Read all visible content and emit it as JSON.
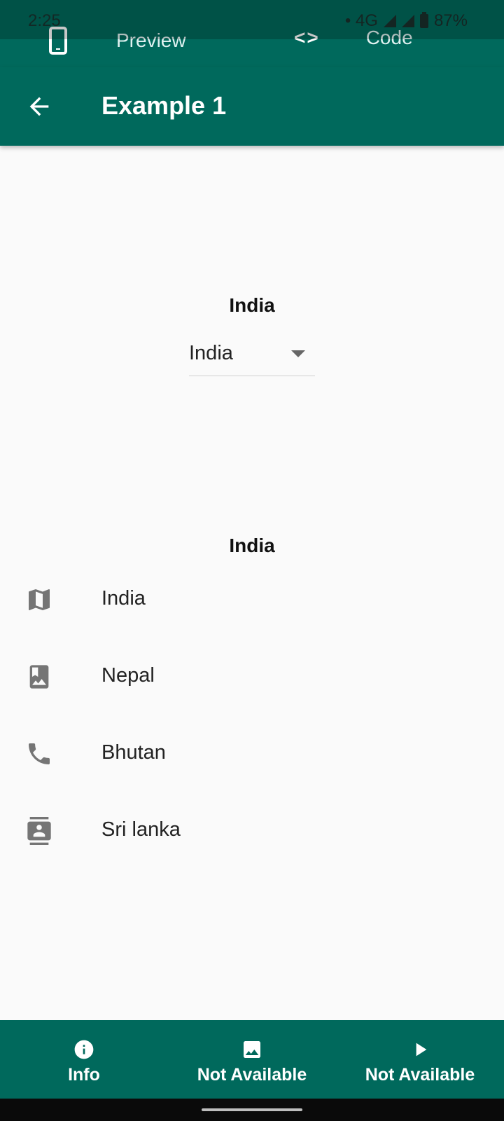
{
  "status": {
    "time": "2:25",
    "network": "• 4G",
    "battery": "87%"
  },
  "top_tabs": {
    "preview": "Preview",
    "code": "Code"
  },
  "appbar": {
    "title": "Example 1"
  },
  "section1": {
    "heading": "India",
    "dropdown_value": "India"
  },
  "section2": {
    "heading": "India",
    "items": [
      {
        "label": "India",
        "icon": "map-icon"
      },
      {
        "label": "Nepal",
        "icon": "photo-album-icon"
      },
      {
        "label": "Bhutan",
        "icon": "phone-icon"
      },
      {
        "label": "Sri lanka",
        "icon": "contacts-icon"
      }
    ]
  },
  "bottom_nav": [
    {
      "label": "Info",
      "icon": "info-icon"
    },
    {
      "label": "Not Available",
      "icon": "image-icon"
    },
    {
      "label": "Not Available",
      "icon": "play-icon"
    }
  ],
  "colors": {
    "primary": "#00695c",
    "background": "#fafafa",
    "icon_gray": "#757575"
  }
}
